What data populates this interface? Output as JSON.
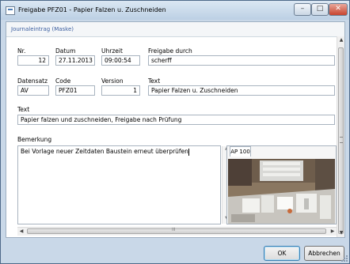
{
  "window": {
    "title": "Freigabe PFZ01 - Papier Falzen u. Zuschneiden",
    "minimize_glyph": "–",
    "maximize_glyph": "□",
    "close_glyph": "✕"
  },
  "header": {
    "label": "Journaleintrag (Maske)"
  },
  "row1": {
    "nr_label": "Nr.",
    "nr_value": "12",
    "datum_label": "Datum",
    "datum_value": "27.11.2013",
    "uhrzeit_label": "Uhrzeit",
    "uhrzeit_value": "09:00:54",
    "freigabe_label": "Freigabe durch",
    "freigabe_value": "scherff"
  },
  "row2": {
    "datensatz_label": "Datensatz",
    "datensatz_value": "AV",
    "code_label": "Code",
    "code_value": "PFZ01",
    "version_label": "Version",
    "version_value": "1",
    "text_label": "Text",
    "text_value": "Papier Falzen u. Zuschneiden"
  },
  "text_field": {
    "label": "Text",
    "value": "Papier falzen und zuschneiden, Freigabe nach Prüfung"
  },
  "bemerkung": {
    "label": "Bemerkung",
    "value": "Bei Vorlage neuer Zeitdaten Baustein erneut überprüfen"
  },
  "image_panel": {
    "tab_label": "AP 100"
  },
  "scrollbars": {
    "up": "▲",
    "down": "▼",
    "left": "◀",
    "right": "▶",
    "grip": "III"
  },
  "buttons": {
    "ok": "OK",
    "cancel": "Abbrechen"
  }
}
